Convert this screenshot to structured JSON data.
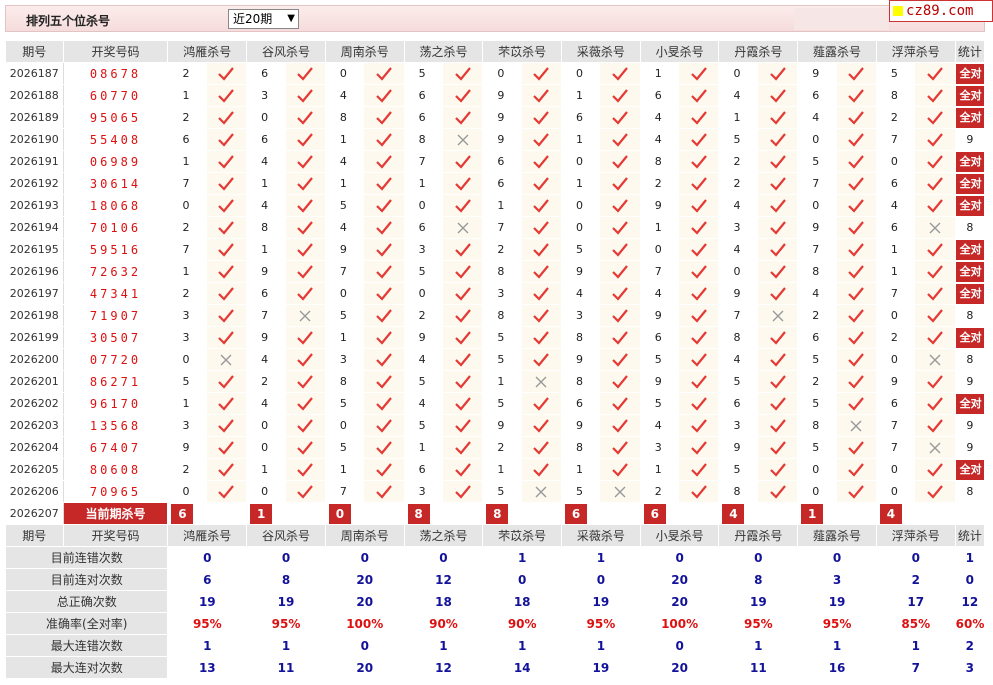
{
  "header": {
    "title": "排列五个位杀号",
    "period_select": "近20期",
    "logo": "cz89.com"
  },
  "columns": {
    "period": "期号",
    "draw": "开奖号码",
    "experts": [
      "鸿雁杀号",
      "谷风杀号",
      "周南杀号",
      "荡之杀号",
      "芣苡杀号",
      "采薇杀号",
      "小旻杀号",
      "丹霞杀号",
      "薤露杀号",
      "浮萍杀号"
    ],
    "stat": "统计"
  },
  "rows": [
    {
      "period": "2026187",
      "draw": "08678",
      "kills": [
        2,
        6,
        0,
        5,
        0,
        0,
        1,
        0,
        9,
        5
      ],
      "ok": [
        1,
        1,
        1,
        1,
        1,
        1,
        1,
        1,
        1,
        1
      ],
      "stat": "全对"
    },
    {
      "period": "2026188",
      "draw": "60770",
      "kills": [
        1,
        3,
        4,
        6,
        9,
        1,
        6,
        4,
        6,
        8
      ],
      "ok": [
        1,
        1,
        1,
        1,
        1,
        1,
        1,
        1,
        1,
        1
      ],
      "stat": "全对"
    },
    {
      "period": "2026189",
      "draw": "95065",
      "kills": [
        2,
        0,
        8,
        6,
        9,
        6,
        4,
        1,
        4,
        2
      ],
      "ok": [
        1,
        1,
        1,
        1,
        1,
        1,
        1,
        1,
        1,
        1
      ],
      "stat": "全对"
    },
    {
      "period": "2026190",
      "draw": "55408",
      "kills": [
        6,
        6,
        1,
        8,
        9,
        1,
        4,
        5,
        0,
        7
      ],
      "ok": [
        1,
        1,
        1,
        0,
        1,
        1,
        1,
        1,
        1,
        1
      ],
      "stat": "9"
    },
    {
      "period": "2026191",
      "draw": "06989",
      "kills": [
        1,
        4,
        4,
        7,
        6,
        0,
        8,
        2,
        5,
        0
      ],
      "ok": [
        1,
        1,
        1,
        1,
        1,
        1,
        1,
        1,
        1,
        1
      ],
      "stat": "全对"
    },
    {
      "period": "2026192",
      "draw": "30614",
      "kills": [
        7,
        1,
        1,
        1,
        6,
        1,
        2,
        2,
        7,
        6
      ],
      "ok": [
        1,
        1,
        1,
        1,
        1,
        1,
        1,
        1,
        1,
        1
      ],
      "stat": "全对"
    },
    {
      "period": "2026193",
      "draw": "18068",
      "kills": [
        0,
        4,
        5,
        0,
        1,
        0,
        9,
        4,
        0,
        4
      ],
      "ok": [
        1,
        1,
        1,
        1,
        1,
        1,
        1,
        1,
        1,
        1
      ],
      "stat": "全对"
    },
    {
      "period": "2026194",
      "draw": "70106",
      "kills": [
        2,
        8,
        4,
        6,
        7,
        0,
        1,
        3,
        9,
        6
      ],
      "ok": [
        1,
        1,
        1,
        0,
        1,
        1,
        1,
        1,
        1,
        0
      ],
      "stat": "8"
    },
    {
      "period": "2026195",
      "draw": "59516",
      "kills": [
        7,
        1,
        9,
        3,
        2,
        5,
        0,
        4,
        7,
        1
      ],
      "ok": [
        1,
        1,
        1,
        1,
        1,
        1,
        1,
        1,
        1,
        1
      ],
      "stat": "全对"
    },
    {
      "period": "2026196",
      "draw": "72632",
      "kills": [
        1,
        9,
        7,
        5,
        8,
        9,
        7,
        0,
        8,
        1
      ],
      "ok": [
        1,
        1,
        1,
        1,
        1,
        1,
        1,
        1,
        1,
        1
      ],
      "stat": "全对"
    },
    {
      "period": "2026197",
      "draw": "47341",
      "kills": [
        2,
        6,
        0,
        0,
        3,
        4,
        4,
        9,
        4,
        7
      ],
      "ok": [
        1,
        1,
        1,
        1,
        1,
        1,
        1,
        1,
        1,
        1
      ],
      "stat": "全对"
    },
    {
      "period": "2026198",
      "draw": "71907",
      "kills": [
        3,
        7,
        5,
        2,
        8,
        3,
        9,
        7,
        2,
        0
      ],
      "ok": [
        1,
        0,
        1,
        1,
        1,
        1,
        1,
        0,
        1,
        1
      ],
      "stat": "8"
    },
    {
      "period": "2026199",
      "draw": "30507",
      "kills": [
        3,
        9,
        1,
        9,
        5,
        8,
        6,
        8,
        6,
        2
      ],
      "ok": [
        1,
        1,
        1,
        1,
        1,
        1,
        1,
        1,
        1,
        1
      ],
      "stat": "全对"
    },
    {
      "period": "2026200",
      "draw": "07720",
      "kills": [
        0,
        4,
        3,
        4,
        5,
        9,
        5,
        4,
        5,
        0
      ],
      "ok": [
        0,
        1,
        1,
        1,
        1,
        1,
        1,
        1,
        1,
        0
      ],
      "stat": "8"
    },
    {
      "period": "2026201",
      "draw": "86271",
      "kills": [
        5,
        2,
        8,
        5,
        1,
        8,
        9,
        5,
        2,
        9
      ],
      "ok": [
        1,
        1,
        1,
        1,
        0,
        1,
        1,
        1,
        1,
        1
      ],
      "stat": "9"
    },
    {
      "period": "2026202",
      "draw": "96170",
      "kills": [
        1,
        4,
        5,
        4,
        5,
        6,
        5,
        6,
        5,
        6
      ],
      "ok": [
        1,
        1,
        1,
        1,
        1,
        1,
        1,
        1,
        1,
        1
      ],
      "stat": "全对"
    },
    {
      "period": "2026203",
      "draw": "13568",
      "kills": [
        3,
        0,
        0,
        5,
        9,
        9,
        4,
        3,
        8,
        7
      ],
      "ok": [
        1,
        1,
        1,
        1,
        1,
        1,
        1,
        1,
        0,
        1
      ],
      "stat": "9"
    },
    {
      "period": "2026204",
      "draw": "67407",
      "kills": [
        9,
        0,
        5,
        1,
        2,
        8,
        3,
        9,
        5,
        7
      ],
      "ok": [
        1,
        1,
        1,
        1,
        1,
        1,
        1,
        1,
        1,
        0
      ],
      "stat": "9"
    },
    {
      "period": "2026205",
      "draw": "80608",
      "kills": [
        2,
        1,
        1,
        6,
        1,
        1,
        1,
        5,
        0,
        0
      ],
      "ok": [
        1,
        1,
        1,
        1,
        1,
        1,
        1,
        1,
        1,
        1
      ],
      "stat": "全对"
    },
    {
      "period": "2026206",
      "draw": "70965",
      "kills": [
        0,
        0,
        7,
        3,
        5,
        5,
        2,
        8,
        0,
        0
      ],
      "ok": [
        1,
        1,
        1,
        1,
        0,
        0,
        1,
        1,
        1,
        1
      ],
      "stat": "8"
    }
  ],
  "current": {
    "period": "2026207",
    "label": "当前期杀号",
    "kills": [
      "6",
      "1",
      "0",
      "8",
      "8",
      "6",
      "6",
      "4",
      "1",
      "4"
    ]
  },
  "stats": [
    {
      "label": "目前连错次数",
      "values": [
        "0",
        "0",
        "0",
        "0",
        "1",
        "1",
        "0",
        "0",
        "0",
        "0",
        "1"
      ]
    },
    {
      "label": "目前连对次数",
      "values": [
        "6",
        "8",
        "20",
        "12",
        "0",
        "0",
        "20",
        "8",
        "3",
        "2",
        "0"
      ]
    },
    {
      "label": "总正确次数",
      "values": [
        "19",
        "19",
        "20",
        "18",
        "18",
        "19",
        "20",
        "19",
        "19",
        "17",
        "12"
      ]
    },
    {
      "label": "准确率(全对率)",
      "values": [
        "95%",
        "95%",
        "100%",
        "90%",
        "90%",
        "95%",
        "100%",
        "95%",
        "95%",
        "85%",
        "60%"
      ],
      "red": true
    },
    {
      "label": "最大连错次数",
      "values": [
        "1",
        "1",
        "0",
        "1",
        "1",
        "1",
        "0",
        "1",
        "1",
        "1",
        "2"
      ]
    },
    {
      "label": "最大连对次数",
      "values": [
        "13",
        "11",
        "20",
        "12",
        "14",
        "19",
        "20",
        "11",
        "16",
        "7",
        "3"
      ]
    }
  ],
  "colors": {
    "accent": "#c62828",
    "check": "#e53935",
    "cross": "#999999",
    "stat_blue": "#12129a",
    "header_bg": "#e5e5e5",
    "mark_bg": "#fdf9ee"
  },
  "icons": {
    "ok": "check-icon",
    "miss": "cross-icon"
  }
}
